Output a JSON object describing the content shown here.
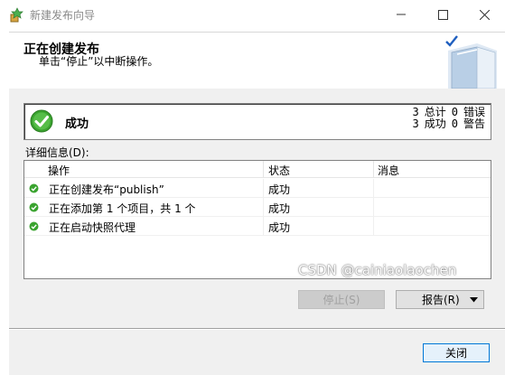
{
  "window": {
    "title": "新建发布向导"
  },
  "header": {
    "title": "正在创建发布",
    "subtitle": "单击“停止”以中断操作。"
  },
  "status": {
    "label": "成功",
    "total_count": "3",
    "total_label": "总计",
    "error_count": "0",
    "error_label": "错误",
    "success_count": "3",
    "success_label": "成功",
    "warning_count": "0",
    "warning_label": "警告"
  },
  "details": {
    "label": "详细信息(D):",
    "columns": [
      "操作",
      "状态",
      "消息"
    ],
    "rows": [
      {
        "action": "正在创建发布“publish”",
        "status": "成功",
        "message": ""
      },
      {
        "action": "正在添加第 1 个项目，共 1 个",
        "status": "成功",
        "message": ""
      },
      {
        "action": "正在启动快照代理",
        "status": "成功",
        "message": ""
      }
    ]
  },
  "buttons": {
    "stop": "停止(S)",
    "report": "报告(R)",
    "close": "关闭"
  },
  "watermark": "CSDN @cainiaolaochen",
  "colors": {
    "success_green": "#3aa32f",
    "accent_blue": "#0078d7"
  },
  "icons": [
    "app-wizard-icon",
    "minimize-icon",
    "maximize-icon",
    "close-icon",
    "success-check-icon",
    "book-wizard-art",
    "dropdown-arrow-icon"
  ]
}
